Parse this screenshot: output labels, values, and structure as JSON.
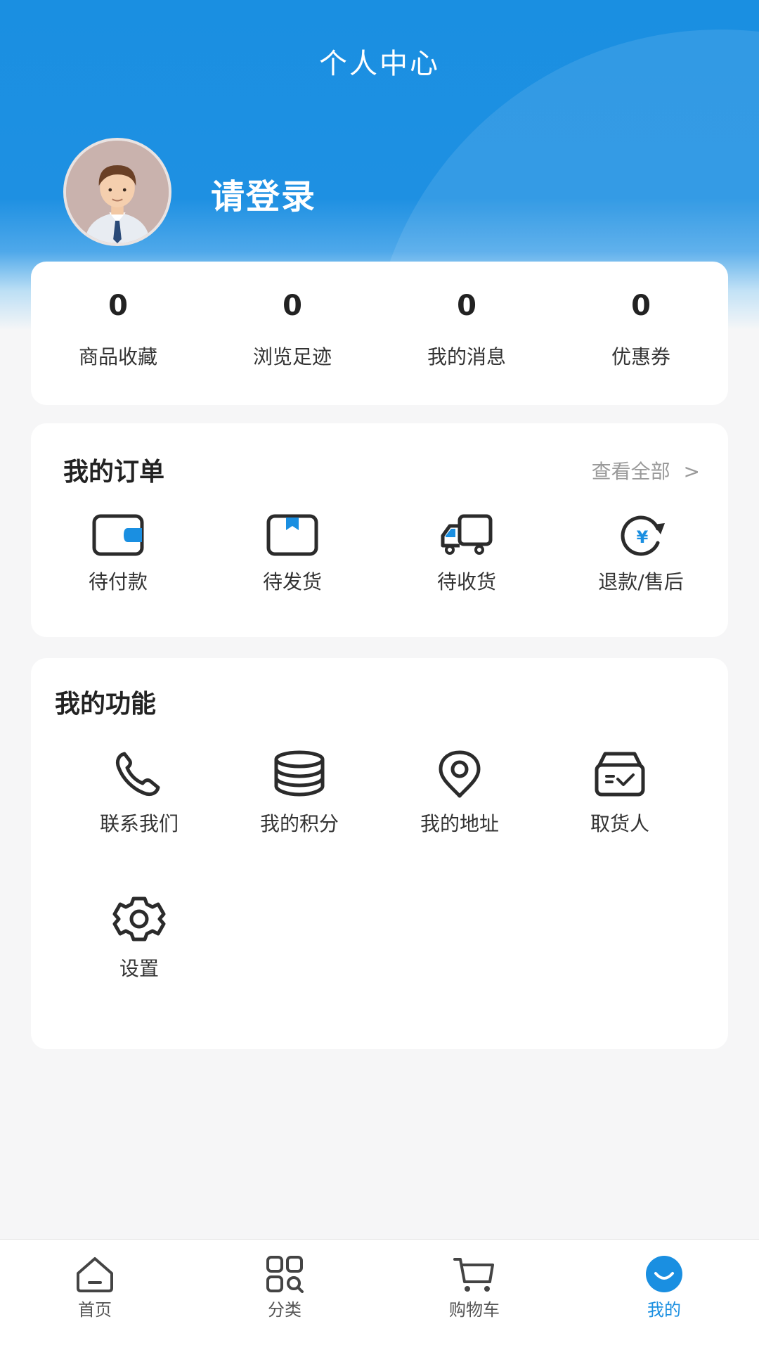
{
  "header": {
    "title": "个人中心",
    "login_prompt": "请登录"
  },
  "stats": [
    {
      "value": "0",
      "label": "商品收藏"
    },
    {
      "value": "0",
      "label": "浏览足迹"
    },
    {
      "value": "0",
      "label": "我的消息"
    },
    {
      "value": "0",
      "label": "优惠券"
    }
  ],
  "orders": {
    "title": "我的订单",
    "view_all": "查看全部",
    "items": [
      {
        "label": "待付款",
        "icon": "wallet-icon"
      },
      {
        "label": "待发货",
        "icon": "box-icon"
      },
      {
        "label": "待收货",
        "icon": "truck-icon"
      },
      {
        "label": "退款/售后",
        "icon": "refund-icon"
      }
    ]
  },
  "functions": {
    "title": "我的功能",
    "items": [
      {
        "label": "联系我们",
        "icon": "phone-icon"
      },
      {
        "label": "我的积分",
        "icon": "coins-icon"
      },
      {
        "label": "我的地址",
        "icon": "location-pin-icon"
      },
      {
        "label": "取货人",
        "icon": "inbox-check-icon"
      },
      {
        "label": "设置",
        "icon": "gear-icon"
      }
    ]
  },
  "tabbar": {
    "items": [
      {
        "label": "首页",
        "icon": "home-icon"
      },
      {
        "label": "分类",
        "icon": "grid-icon"
      },
      {
        "label": "购物车",
        "icon": "cart-icon"
      },
      {
        "label": "我的",
        "icon": "profile-smile-icon",
        "active": true
      }
    ]
  },
  "colors": {
    "accent": "#1a8fe1",
    "header_bg": "#1e90e2",
    "card_bg": "#ffffff",
    "page_bg": "#f6f6f7"
  }
}
